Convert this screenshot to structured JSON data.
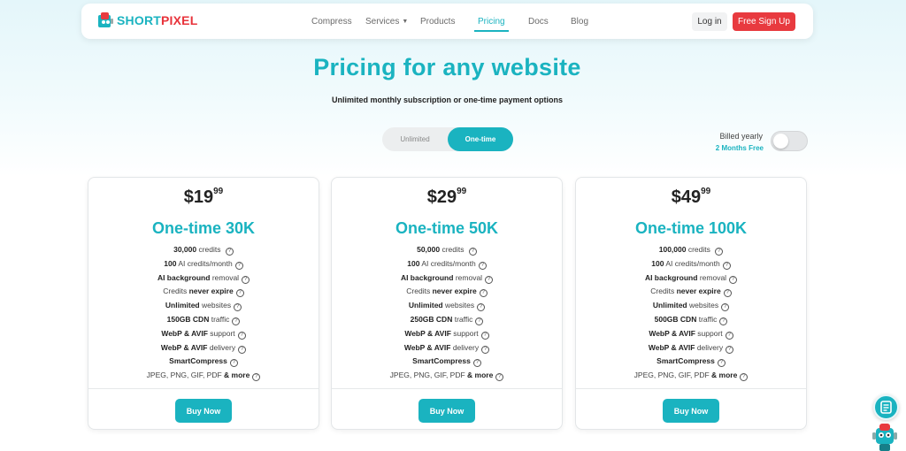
{
  "brand": {
    "name_part1": "SHORT",
    "name_part2": "PIXEL",
    "colors": {
      "teal": "#1ab3c0",
      "red": "#e83a3f"
    }
  },
  "nav": {
    "items": [
      "Compress",
      "Services",
      "Products",
      "Pricing",
      "Docs",
      "Blog"
    ],
    "active": "Pricing",
    "login": "Log in",
    "signup": "Free Sign Up"
  },
  "hero": {
    "title": "Pricing for any website",
    "subtitle": "Unlimited monthly subscription or one-time payment options"
  },
  "plan_toggle": {
    "options": [
      "Unlimited",
      "One-time"
    ],
    "selected": "One-time"
  },
  "billing": {
    "label": "Billed yearly",
    "promo": "2 Months Free",
    "enabled": false
  },
  "plans": [
    {
      "price_dollars": "$19",
      "price_cents": "99",
      "name": "One-time 30K",
      "credits": "30,000",
      "cdn": "150GB CDN",
      "buy": "Buy Now"
    },
    {
      "price_dollars": "$29",
      "price_cents": "99",
      "name": "One-time 50K",
      "credits": "50,000",
      "cdn": "250GB CDN",
      "buy": "Buy Now"
    },
    {
      "price_dollars": "$49",
      "price_cents": "99",
      "name": "One-time 100K",
      "credits": "100,000",
      "cdn": "500GB CDN",
      "buy": "Buy Now"
    }
  ],
  "feature_text": {
    "credits_suffix": "credits",
    "ai_credits_bold": "100",
    "ai_credits_rest": "AI credits/month",
    "ai_bg_bold": "AI background",
    "ai_bg_rest": "removal",
    "never_pre": "Credits",
    "never_bold": "never expire",
    "unlimited_bold": "Unlimited",
    "unlimited_rest": "websites",
    "cdn_rest": "traffic",
    "webp_bold": "WebP & AVIF",
    "webp_support_rest": "support",
    "webp_delivery_rest": "delivery",
    "smart": "SmartCompress",
    "formats_pre": "JPEG, PNG, GIF, PDF",
    "formats_bold": "& more"
  },
  "icons": [
    "logo-icon",
    "chevron-down-icon",
    "help-icon",
    "chat-icon",
    "robot-icon"
  ]
}
